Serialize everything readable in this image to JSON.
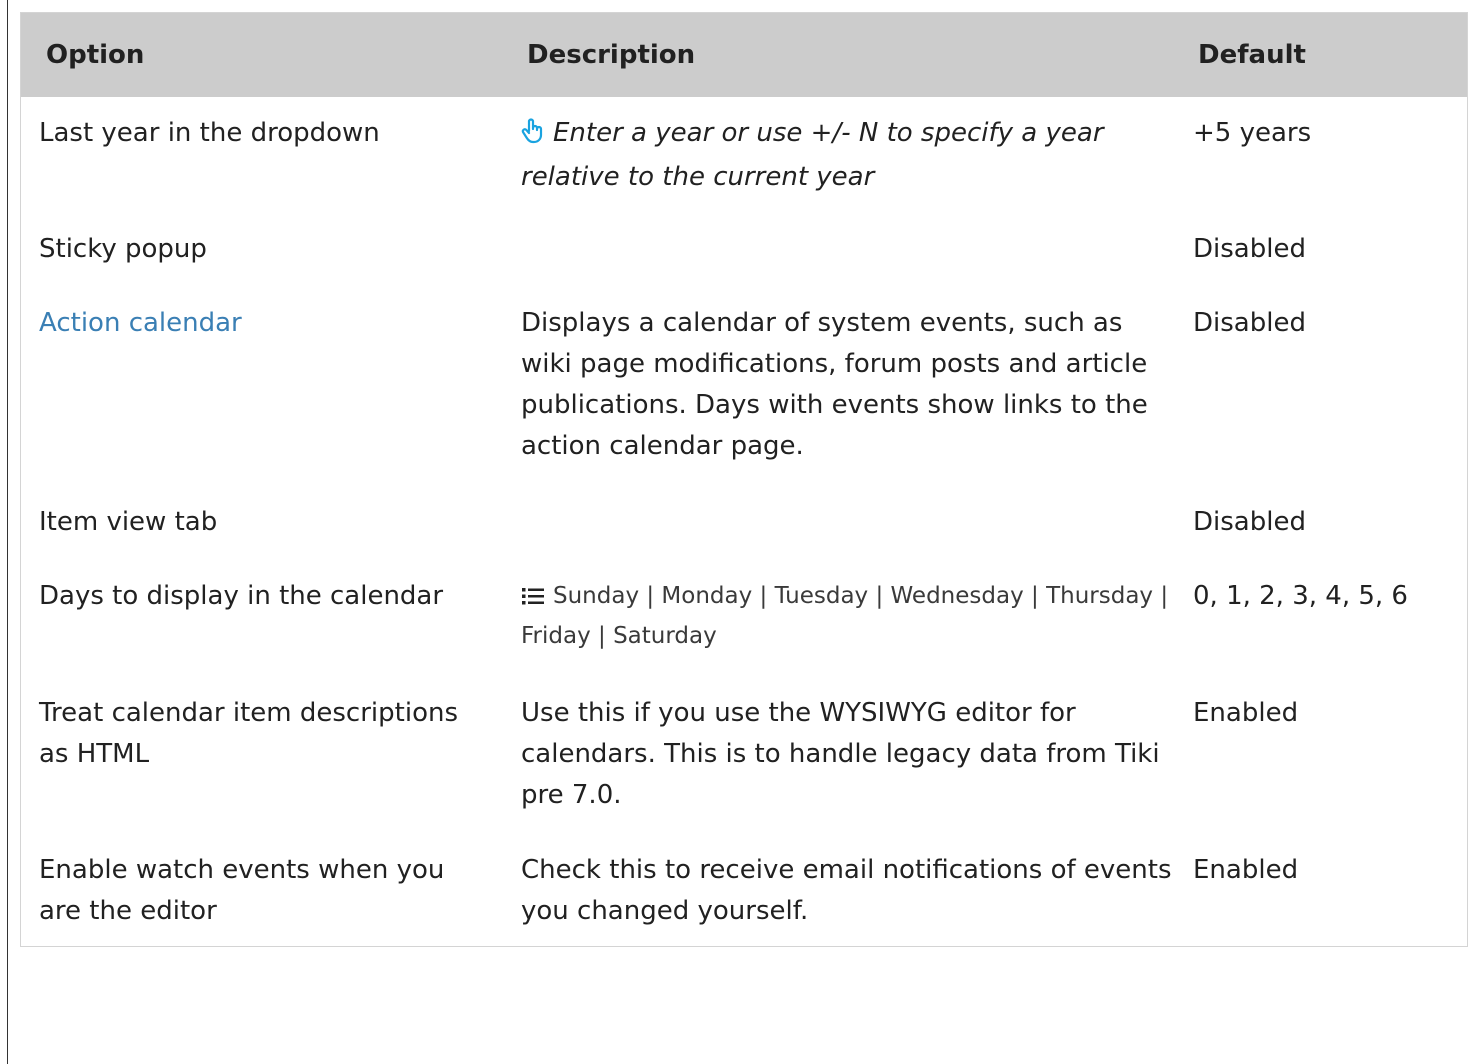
{
  "header": {
    "option": "Option",
    "description": "Description",
    "default": "Default"
  },
  "rows": [
    {
      "option": "Last year in the dropdown",
      "description": "Enter a year or use +/- N to specify a year relative to the current year",
      "description_icon": "pointer-hand-icon",
      "default": "+5 years"
    },
    {
      "option": "Sticky popup",
      "description": "",
      "default": "Disabled"
    },
    {
      "option": "Action calendar",
      "description": "Displays a calendar of system events, such as wiki page modifications, forum posts and article publications. Days with events show links to the action calendar page.",
      "default": "Disabled"
    },
    {
      "option": "Item view tab",
      "description": "",
      "default": "Disabled"
    },
    {
      "option": "Days to display in the calendar",
      "description": "Sunday | Monday | Tuesday | Wednesday | Thursday | Friday | Saturday",
      "description_icon": "list-icon",
      "default": "0, 1, 2, 3, 4, 5, 6"
    },
    {
      "option": "Treat calendar item descriptions as HTML",
      "description": "Use this if you use the WYSIWYG editor for calendars. This is to handle legacy data from Tiki pre 7.0.",
      "default": "Enabled"
    },
    {
      "option": "Enable watch events when you are the editor",
      "description": "Check this to receive email notifications of events you changed yourself.",
      "default": "Enabled"
    }
  ],
  "colors": {
    "header_bg": "#cccccc",
    "link": "#3a7fb4",
    "icon_accent": "#1aa3e0"
  }
}
